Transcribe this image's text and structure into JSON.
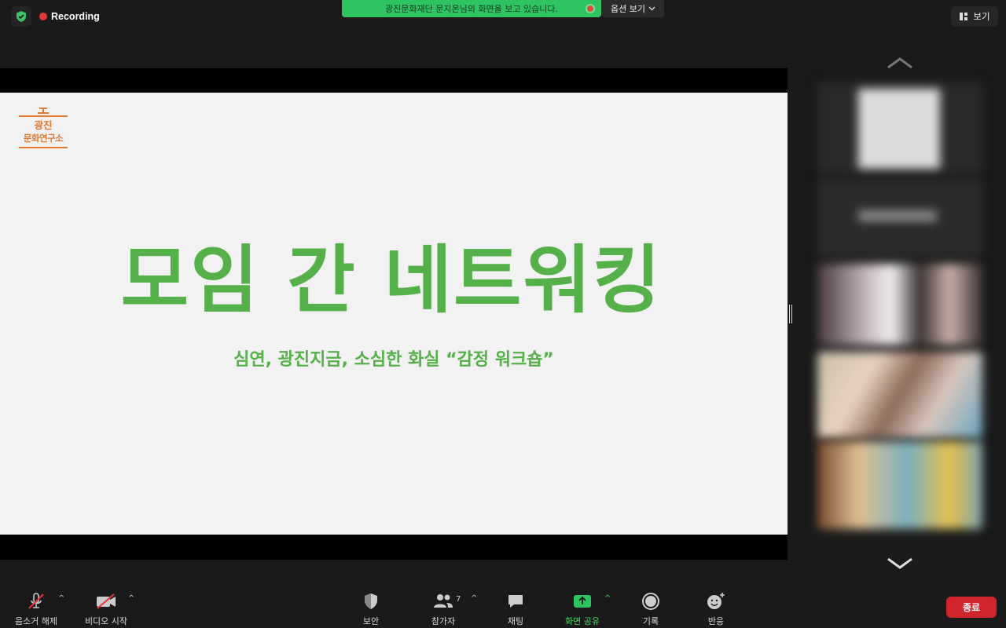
{
  "topbar": {
    "recording_label": "Recording",
    "share_banner": "광진문화재단 문지온님의 화면을 보고 있습니다.",
    "options_label": "옵션 보기",
    "view_label": "보기"
  },
  "slide": {
    "logo_line1": "광진",
    "logo_line2": "문화연구소",
    "title": "모임 간 네트워킹",
    "subtitle": "심연, 광진지금, 소심한 화실 “감정 워크숍”"
  },
  "toolbar": {
    "mute_label": "음소거 해제",
    "video_label": "비디오 시작",
    "security_label": "보안",
    "participants_label": "참가자",
    "participants_count": "7",
    "chat_label": "채팅",
    "share_label": "화면 공유",
    "record_label": "기록",
    "reactions_label": "반응",
    "end_label": "종료"
  },
  "colors": {
    "accent_green": "#2fc462",
    "slide_green": "#56b04a",
    "logo_orange": "#e07a30",
    "end_red": "#d0252b"
  }
}
